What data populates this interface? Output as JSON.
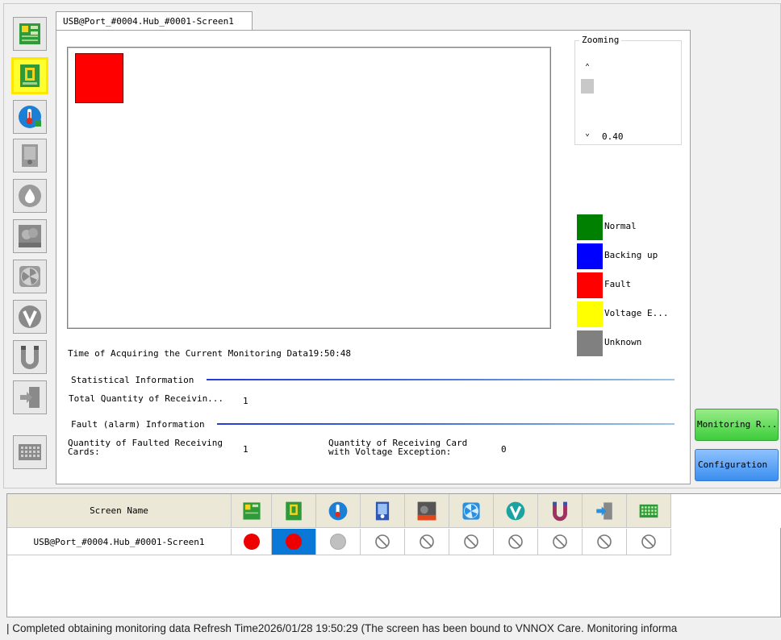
{
  "tab": {
    "title": "USB@Port_#0004.Hub_#0001-Screen1"
  },
  "toolbar": {
    "items": [
      {
        "name": "receiving-card-icon",
        "selected": false
      },
      {
        "name": "card-module-icon",
        "selected": true
      },
      {
        "name": "temperature-icon",
        "selected": false
      },
      {
        "name": "fan-board-icon",
        "selected": false
      },
      {
        "name": "humidity-icon",
        "selected": false
      },
      {
        "name": "smoke-icon",
        "selected": false
      },
      {
        "name": "fan-icon",
        "selected": false
      },
      {
        "name": "voltage-icon",
        "selected": false
      },
      {
        "name": "cable-icon",
        "selected": false
      },
      {
        "name": "door-icon",
        "selected": false
      },
      {
        "name": "module-grid-icon",
        "selected": false
      }
    ]
  },
  "zoom": {
    "label": "Zooming",
    "value": "0.40"
  },
  "legend": [
    {
      "label": "Normal",
      "color": "#008000"
    },
    {
      "label": "Backing up",
      "color": "#0000ff"
    },
    {
      "label": "Fault",
      "color": "#ff0000"
    },
    {
      "label": "Voltage E...",
      "color": "#ffff00"
    },
    {
      "label": "Unknown",
      "color": "#808080"
    }
  ],
  "acquire": {
    "label": "Time of Acquiring the Current Monitoring Data",
    "time": "19:50:48"
  },
  "stats": {
    "title": "Statistical Information",
    "total_label": "Total Quantity of Receivin...",
    "total_value": "1"
  },
  "fault": {
    "title": "Fault (alarm) Information",
    "faulted_label_1": "Quantity of Faulted Receiving",
    "faulted_label_2": "Cards:",
    "faulted_value": "1",
    "voltage_label_1": "Quantity of Receiving Card",
    "voltage_label_2": "with Voltage Exception:",
    "voltage_value": "0"
  },
  "buttons": {
    "monitoring": "Monitoring R...",
    "configuration": "Configuration"
  },
  "table": {
    "header_screen": "Screen Name",
    "row_name": "USB@Port_#0004.Hub_#0001-Screen1",
    "statuses": [
      "fault",
      "fault",
      "unknown",
      "disabled",
      "disabled",
      "disabled",
      "disabled",
      "disabled",
      "disabled",
      "disabled"
    ]
  },
  "status_bar": "| Completed obtaining monitoring data Refresh Time2026/01/28 19:50:29 (The screen has been bound to VNNOX Care. Monitoring informa"
}
